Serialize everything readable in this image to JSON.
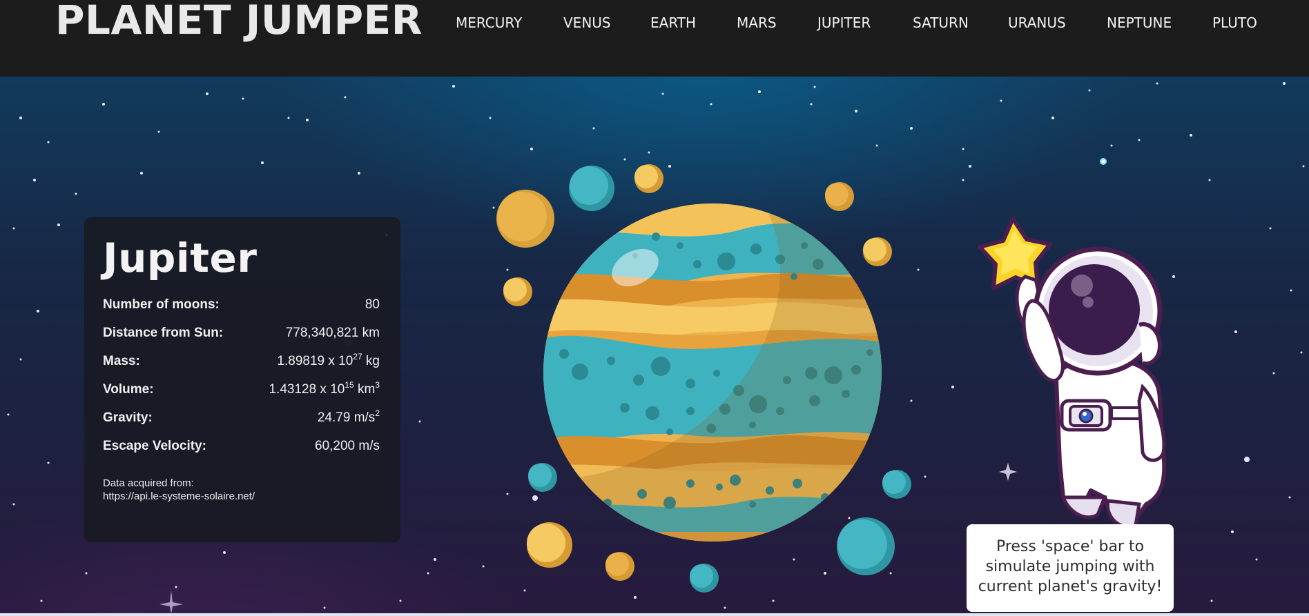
{
  "header": {
    "title": "PLANET JUMPER",
    "nav": [
      "MERCURY",
      "VENUS",
      "EARTH",
      "MARS",
      "JUPITER",
      "SATURN",
      "URANUS",
      "NEPTUNE",
      "PLUTO"
    ]
  },
  "planet": {
    "name": "Jupiter",
    "stats": {
      "moons_label": "Number of moons:",
      "moons_value": "80",
      "distance_label": "Distance from Sun:",
      "distance_value": "778,340,821 km",
      "mass_label": "Mass:",
      "mass_base": "1.89819 x 10",
      "mass_exp": "27",
      "mass_unit": " kg",
      "volume_label": "Volume:",
      "volume_base": "1.43128 x 10",
      "volume_exp": "15",
      "volume_unit": " km",
      "volume_unit_exp": "3",
      "gravity_label": "Gravity:",
      "gravity_value": "24.79 m/s",
      "gravity_exp": "2",
      "escape_label": "Escape Velocity:",
      "escape_value": "60,200 m/s"
    },
    "source_label": "Data acquired from:",
    "source_url": "https://api.le-systeme-solaire.net/"
  },
  "hint": "Press 'space' bar to simulate jumping with current planet's gravity!",
  "colors": {
    "header_bg": "#1c1c1c",
    "planet_yellow": "#f3c35a",
    "planet_orange": "#d98f2b",
    "planet_teal": "#3fb2bf",
    "star_yellow": "#fbd428",
    "visor_purple": "#3b1d4d"
  },
  "icons": {
    "star": "star-icon",
    "astronaut": "astronaut-illustration",
    "planet": "jupiter-illustration"
  }
}
